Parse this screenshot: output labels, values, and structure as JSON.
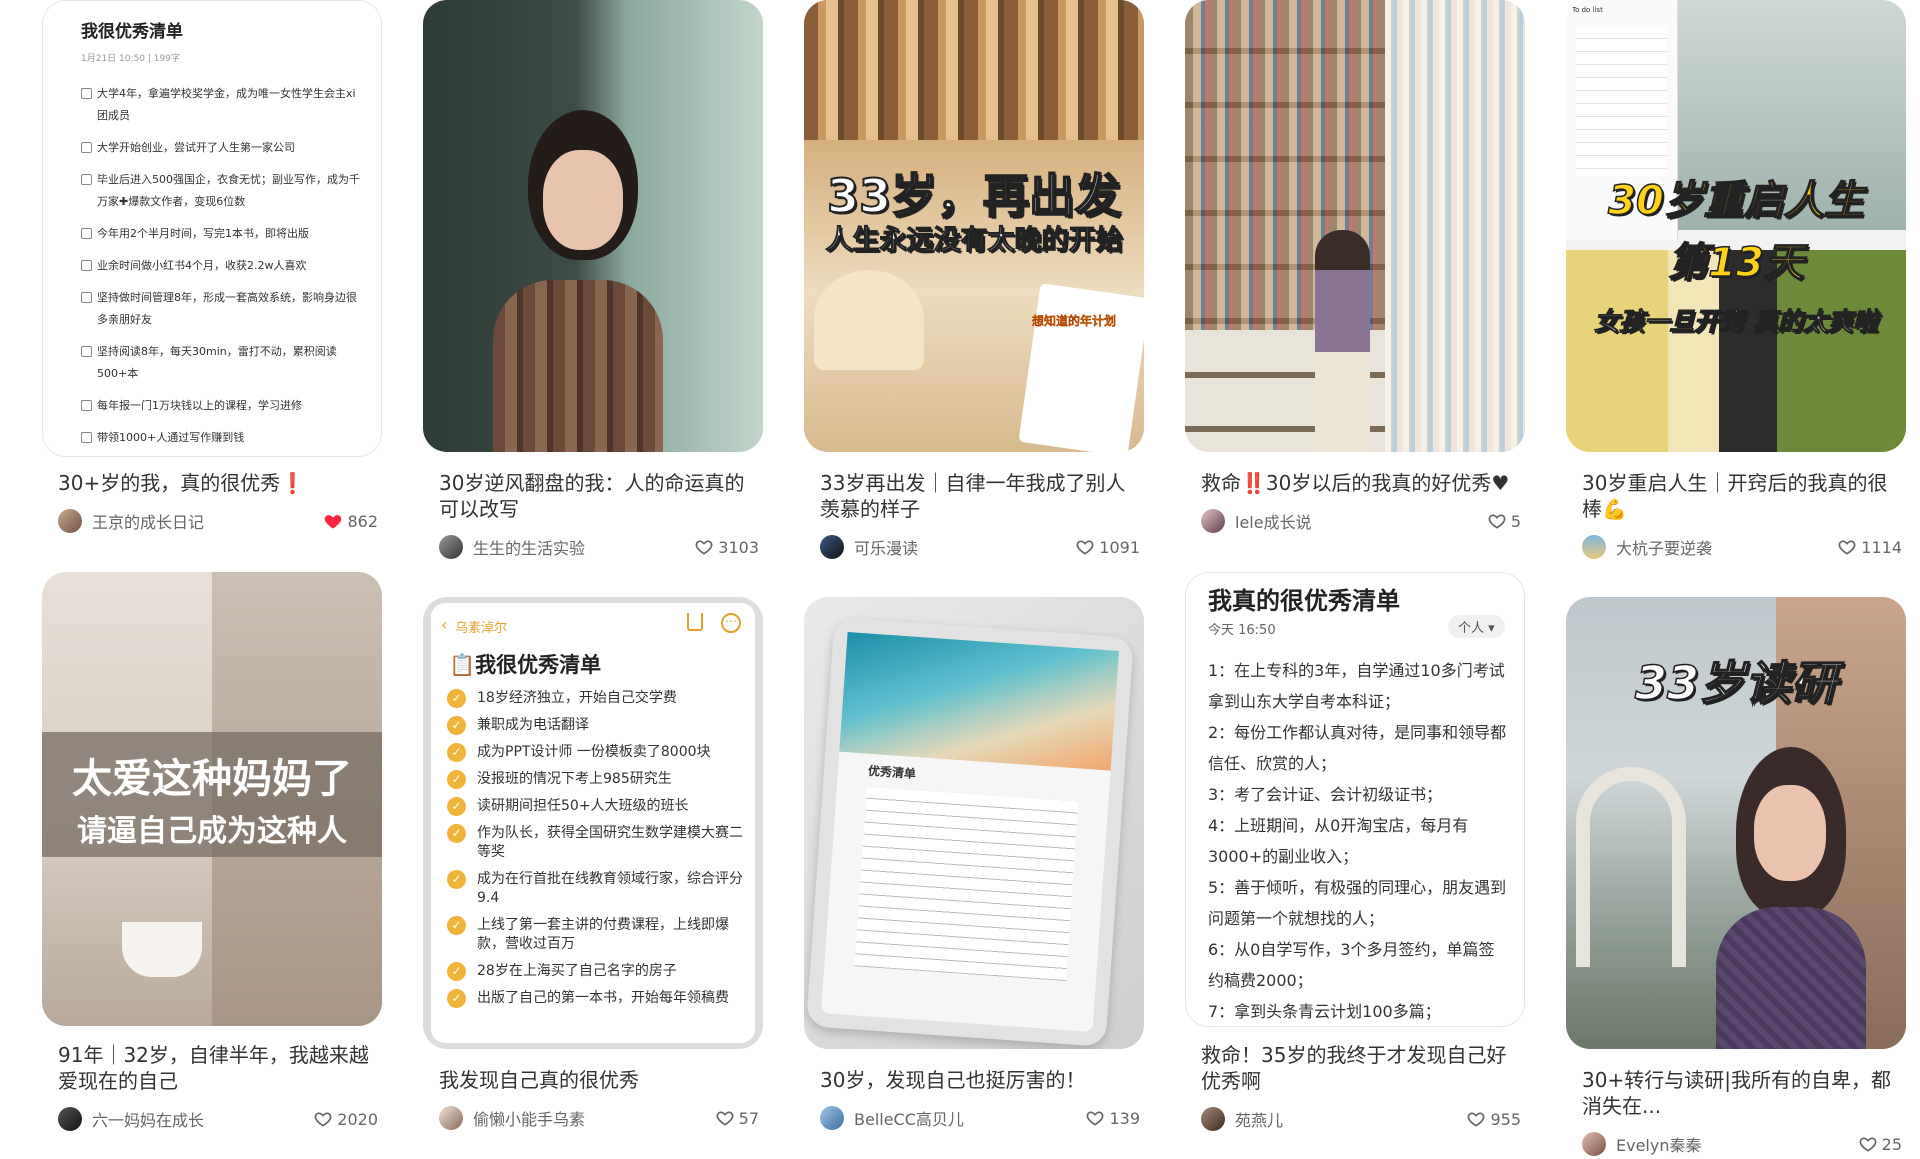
{
  "cards": [
    {
      "title": "30+岁的我，真的很优秀❗",
      "author": "王京的成长日记",
      "likes": "862",
      "liked": true,
      "cover": {
        "heading": "我很优秀清单",
        "sub": "1月21日 10:50 | 199字",
        "items": [
          "大学4年，拿遍学校奖学金，成为唯一女性学生会主xi团成员",
          "大学开始创业，尝试开了人生第一家公司",
          "毕业后进入500强国企，衣食无忧；副业写作，成为千万家✚爆款文作者，变现6位数",
          "今年用2个半月时间，写完1本书，即将出版",
          "业余时间做小红书4个月，收获2.2w人喜欢",
          "坚持做时间管理8年，形成一套高效系统，影响身边很多亲朋好友",
          "坚持阅读8年，每天30min，雷打不动，累积阅读500+本",
          "每年报一门1万块钱以上的课程，学习进修",
          "带领1000+人通过写作赚到钱"
        ]
      }
    },
    {
      "title": "30岁逆风翻盘的我：人的命运真的可以改写",
      "author": "生生的生活实验",
      "likes": "3103",
      "liked": false
    },
    {
      "title": "33岁再出发｜自律一年我成了别人羡慕的样子",
      "author": "可乐漫读",
      "likes": "1091",
      "liked": false,
      "cover": {
        "big": "33岁，再出发",
        "sub": "人生永远没有太晚的开始",
        "tag": "想知道的年计划"
      }
    },
    {
      "title": "救命‼️30岁以后的我真的好优秀♥",
      "author": "lele成长说",
      "likes": "5",
      "liked": false
    },
    {
      "title": "30岁重启人生｜开窍后的我真的很棒💪",
      "author": "大杭子要逆袭",
      "likes": "1114",
      "liked": false,
      "cover": {
        "l1": "30岁重启人生",
        "l2": "第13天",
        "l3": "女孩一旦开窍 真的太爽啦",
        "todo": "To do list"
      }
    },
    {
      "title": "91年｜32岁，自律半年，我越来越爱现在的自己",
      "author": "六一妈妈在成长",
      "likes": "2020",
      "liked": false,
      "cover": {
        "l1": "太爱这种妈妈了",
        "l2": "请逼自己成为这种人"
      }
    },
    {
      "title": "我发现自己真的很优秀",
      "author": "偷懒小能手乌素",
      "likes": "57",
      "liked": false,
      "cover": {
        "back": "乌素淖尔",
        "heading": "📋我很优秀清单",
        "items": [
          "18岁经济独立，开始自己交学费",
          "兼职成为电话翻译",
          "成为PPT设计师 一份模板卖了8000块",
          "没报班的情况下考上985研究生",
          "读研期间担任50+人大班级的班长",
          "作为队长，获得全国研究生数学建模大赛二等奖",
          "成为在行首批在线教育领域行家，综合评分9.4",
          "上线了第一套主讲的付费课程，上线即爆款，营收过百万",
          "28岁在上海买了自己名字的房子",
          "出版了自己的第一本书，开始每年领稿费"
        ]
      }
    },
    {
      "title": "30岁，发现自己也挺厉害的！",
      "author": "BelleCC高贝儿",
      "likes": "139",
      "liked": false,
      "cover": {
        "doc": "优秀清单"
      }
    },
    {
      "title": "救命！35岁的我终于才发现自己好优秀啊",
      "author": "苑燕儿",
      "likes": "955",
      "liked": false,
      "cover": {
        "heading": "我真的很优秀清单",
        "date": "今天 16:50",
        "badge": "个人 ▾",
        "items": [
          "1：在上专科的3年，自学通过10多门考试拿到山东大学自考本科证；",
          "2：每份工作都认真对待，是同事和领导都信任、欣赏的人；",
          "3：考了会计证、会计初级证书；",
          "4：上班期间，从0开淘宝店，每月有3000+的副业收入；",
          "5：善于倾听，有极强的同理心，朋友遇到问题第一个就想找的人；",
          "6：从0自学写作，3个多月签约，单篇签约稿费2000；",
          "7：拿到头条青云计划100多篇；"
        ]
      }
    },
    {
      "title": "30+转行与读研|我所有的自卑，都消失在...",
      "author": "Evelyn秦秦",
      "likes": "25",
      "liked": false,
      "cover": {
        "big": "33岁读研"
      }
    }
  ]
}
